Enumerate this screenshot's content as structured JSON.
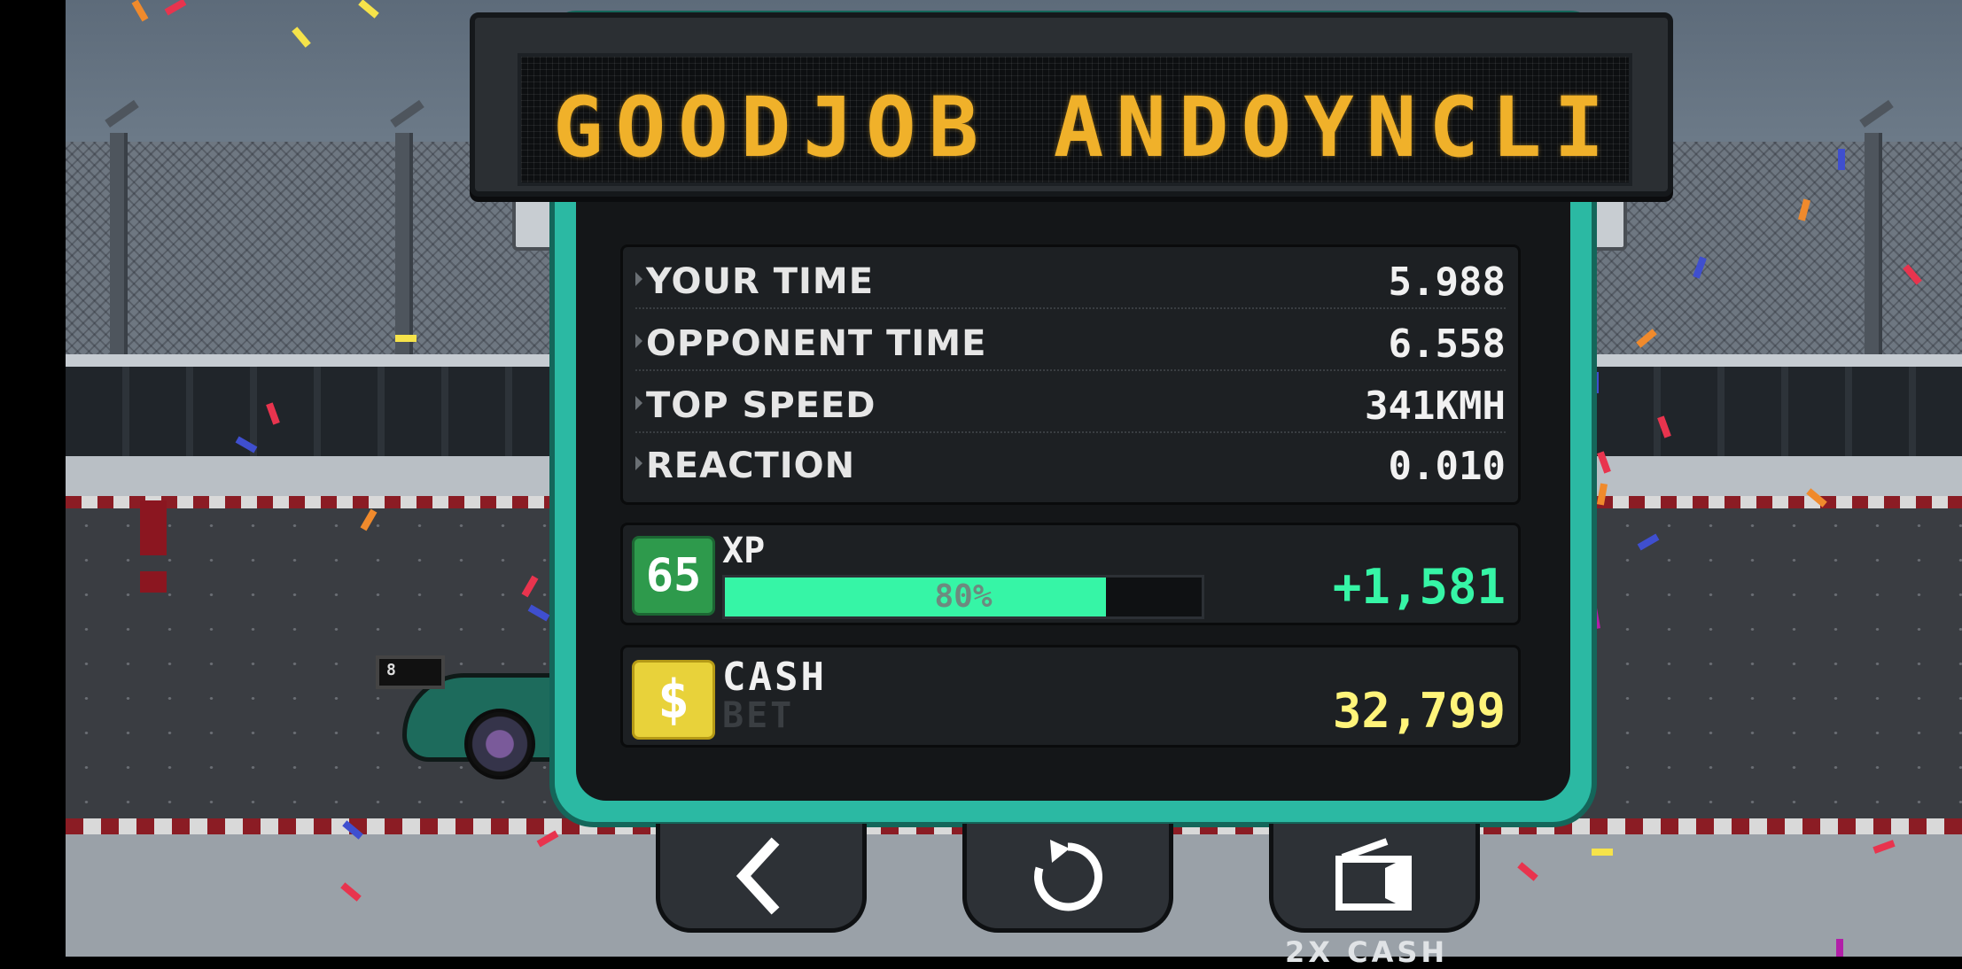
{
  "banner": {
    "text": "GOODJOB ANDOYNCLI"
  },
  "stats": [
    {
      "label": "YOUR TIME",
      "value": "5.988"
    },
    {
      "label": "OPPONENT TIME",
      "value": "6.558"
    },
    {
      "label": "TOP SPEED",
      "value": "341KMH"
    },
    {
      "label": "REACTION",
      "value": "0.010"
    }
  ],
  "xp": {
    "level": "65",
    "label": "XP",
    "progress_text": "80%",
    "progress": 0.8,
    "gain": "+1,581"
  },
  "cash": {
    "icon_symbol": "$",
    "label": "CASH",
    "bet_label": "BET",
    "value": "32,799"
  },
  "buttons": {
    "back_icon": "chevron-left-icon",
    "retry_icon": "refresh-icon",
    "video_icon": "video-camera-icon",
    "video_caption": "2X CASH"
  },
  "car": {
    "plate": "8"
  },
  "colors": {
    "panel": "#2bb9a3",
    "banner_text": "#f0b12a",
    "xp_green": "#36f5a6",
    "cash_yellow": "#fff47a"
  }
}
